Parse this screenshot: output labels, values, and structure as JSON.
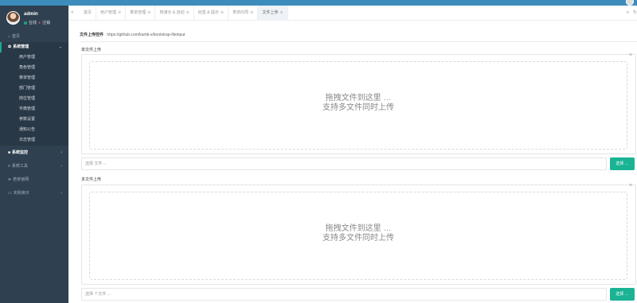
{
  "user": {
    "name": "admin",
    "status": "在线",
    "logout": "注销"
  },
  "sidebar": {
    "home": "首页",
    "system_manage": {
      "label": "系统管理",
      "items": [
        "用户管理",
        "角色管理",
        "菜单管理",
        "部门管理",
        "岗位管理",
        "字典管理",
        "参数设置",
        "通知公告",
        "日志管理"
      ]
    },
    "system_monitor": "系统监控",
    "system_tools": "系统工具",
    "official_site": "若依官网",
    "demo": "实例演示"
  },
  "tabs": [
    {
      "label": "首页",
      "closable": false
    },
    {
      "label": "用户管理",
      "closable": true
    },
    {
      "label": "菜单管理",
      "closable": true
    },
    {
      "label": "热演示 & 自动",
      "closable": true
    },
    {
      "label": "标签 & 提示",
      "closable": true
    },
    {
      "label": "表单向导",
      "closable": true
    },
    {
      "label": "文件上传",
      "closable": true,
      "active": true
    }
  ],
  "page": {
    "title": "文件上传控件",
    "url": "https://github.com/kartik-v/bootstrap-fileinput"
  },
  "single_upload": {
    "label": "单文件上传",
    "drop_text_1": "拖拽文件到这里 …",
    "drop_text_2": "支持多文件同时上传",
    "placeholder": "选择 文件 ...",
    "browse": "选择 …"
  },
  "multi_upload": {
    "label": "多文件上传",
    "drop_text_1": "拖拽文件到这里 …",
    "drop_text_2": "支持多文件同时上传",
    "placeholder": "选择 个文件 ...",
    "browse": "选择 …"
  },
  "colors": {
    "sidebar": "#2f4050",
    "topbar": "#3c8dbc",
    "accent": "#1ab394"
  }
}
